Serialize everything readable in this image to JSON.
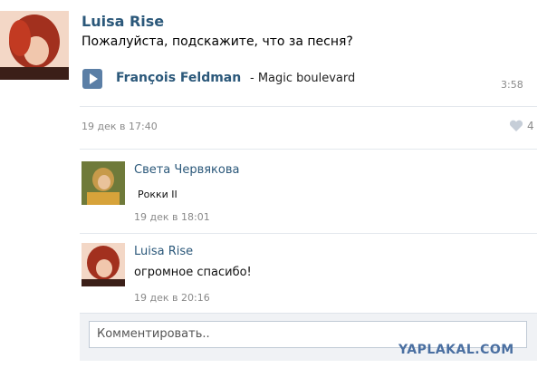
{
  "post": {
    "author": "Luisa Rise",
    "text": "Пожалуйста, подскажите, что за песня?",
    "audio": {
      "artist": "François Feldman",
      "separator": " - ",
      "title": "Magic boulevard",
      "duration": "3:58"
    },
    "date": "19 дек в 17:40",
    "likes": "4"
  },
  "comments": [
    {
      "author": "Света Червякова",
      "text": "Рокки II",
      "date": "19 дек в 18:01"
    },
    {
      "author": "Luisa Rise",
      "text": "огромное спасибо!",
      "date": "19 дек в 20:16"
    }
  ],
  "comment_input": {
    "placeholder": "Комментировать.."
  },
  "watermark": "YAPLAKAL.COM",
  "colors": {
    "link": "#2b587a",
    "meta": "#8a8a8a",
    "accent": "#5b7fa6"
  }
}
